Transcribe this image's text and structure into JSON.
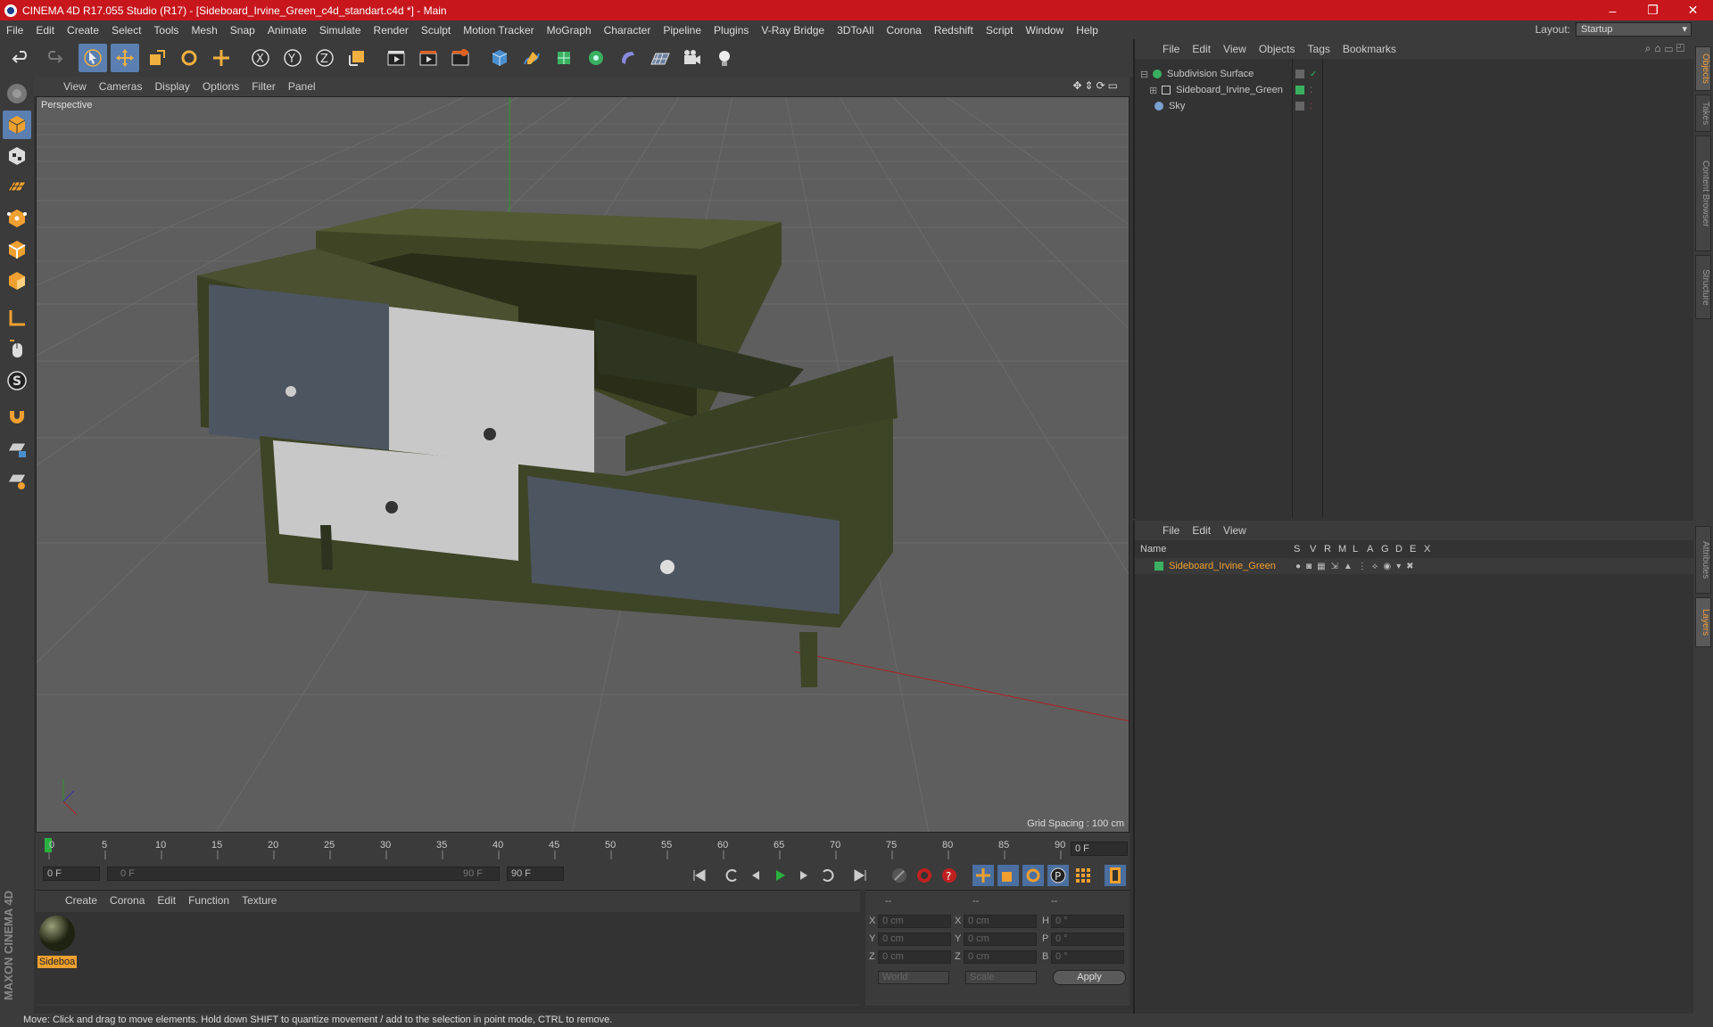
{
  "window": {
    "title": "CINEMA 4D R17.055 Studio (R17) - [Sideboard_Irvine_Green_c4d_standart.c4d *] - Main",
    "controls": [
      "–",
      "❐",
      "✕"
    ]
  },
  "menubar": {
    "items": [
      "File",
      "Edit",
      "Create",
      "Select",
      "Tools",
      "Mesh",
      "Snap",
      "Animate",
      "Simulate",
      "Render",
      "Sculpt",
      "Motion Tracker",
      "MoGraph",
      "Character",
      "Pipeline",
      "Plugins",
      "V-Ray Bridge",
      "3DToAll",
      "Corona",
      "Redshift",
      "Script",
      "Window",
      "Help"
    ],
    "layout_label": "Layout:",
    "layout_value": "Startup"
  },
  "viewport": {
    "menu": [
      "View",
      "Cameras",
      "Display",
      "Options",
      "Filter",
      "Panel"
    ],
    "label": "Perspective",
    "grid_spacing": "Grid Spacing : 100 cm"
  },
  "timeline": {
    "ticks": [
      "0",
      "5",
      "10",
      "15",
      "20",
      "25",
      "30",
      "35",
      "40",
      "45",
      "50",
      "55",
      "60",
      "65",
      "70",
      "75",
      "80",
      "85",
      "90"
    ],
    "current_frame": "0 F"
  },
  "transport": {
    "start_frame": "0 F",
    "range_start": "0 F",
    "range_end": "90 F",
    "end_frame": "90 F"
  },
  "material_panel": {
    "menu": [
      "Create",
      "Corona",
      "Edit",
      "Function",
      "Texture"
    ],
    "materials": [
      {
        "name": "Sideboa"
      }
    ]
  },
  "coordinates": {
    "headers": [
      "--",
      "--",
      "--"
    ],
    "rows": [
      {
        "a_label": "X",
        "a_val": "0 cm",
        "b_label": "X",
        "b_val": "0 cm",
        "c_label": "H",
        "c_val": "0 °"
      },
      {
        "a_label": "Y",
        "a_val": "0 cm",
        "b_label": "Y",
        "b_val": "0 cm",
        "c_label": "P",
        "c_val": "0 °"
      },
      {
        "a_label": "Z",
        "a_val": "0 cm",
        "b_label": "Z",
        "b_val": "0 cm",
        "c_label": "B",
        "c_val": "0 °"
      }
    ],
    "mode1": "World",
    "mode2": "Scale",
    "apply_label": "Apply"
  },
  "object_manager": {
    "menu": [
      "File",
      "Edit",
      "View",
      "Objects",
      "Tags",
      "Bookmarks"
    ],
    "objects": [
      {
        "name": "Subdivision Surface",
        "color": "#ccc"
      },
      {
        "name": "Sideboard_Irvine_Green",
        "color": "#ccc"
      },
      {
        "name": "Sky",
        "color": "#ccc"
      }
    ]
  },
  "layer_manager": {
    "menu": [
      "File",
      "Edit",
      "View"
    ],
    "columns": [
      "Name",
      "S",
      "V",
      "R",
      "M",
      "L",
      "A",
      "G",
      "D",
      "E",
      "X"
    ],
    "layers": [
      {
        "name": "Sideboard_Irvine_Green",
        "color": "#f0a030"
      }
    ]
  },
  "side_tabs": [
    "Objects",
    "Takes",
    "Content Browser",
    "Structure",
    "Attributes",
    "Layers"
  ],
  "status": "Move: Click and drag to move elements. Hold down SHIFT to quantize movement / add to the selection in point mode, CTRL to remove.",
  "colors": {
    "titlebar": "#c8161d",
    "accent": "#f0a030",
    "selected_tool": "#5a7fb0"
  }
}
